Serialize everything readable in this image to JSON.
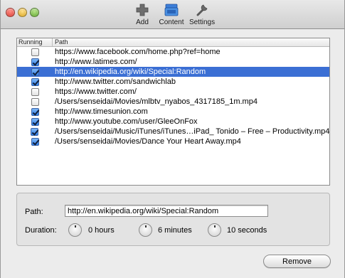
{
  "toolbar": {
    "buttons": [
      {
        "label": "Add",
        "icon": "add-plus-icon"
      },
      {
        "label": "Content",
        "icon": "content-tray-icon"
      },
      {
        "label": "Settings",
        "icon": "wrench-settings-icon"
      }
    ]
  },
  "list": {
    "columns": {
      "running": "Running",
      "path": "Path"
    },
    "rows": [
      {
        "checked": false,
        "path": "https://www.facebook.com/home.php?ref=home",
        "selected": false
      },
      {
        "checked": true,
        "path": "http://www.latimes.com/",
        "selected": false
      },
      {
        "checked": true,
        "path": "http://en.wikipedia.org/wiki/Special:Random",
        "selected": true
      },
      {
        "checked": true,
        "path": "http://www.twitter.com/sandwichlab",
        "selected": false
      },
      {
        "checked": false,
        "path": "https://www.twitter.com/",
        "selected": false
      },
      {
        "checked": false,
        "path": "/Users/senseidai/Movies/mlbtv_nyabos_4317185_1m.mp4",
        "selected": false
      },
      {
        "checked": true,
        "path": "http://www.timesunion.com",
        "selected": false
      },
      {
        "checked": true,
        "path": "http://www.youtube.com/user/GleeOnFox",
        "selected": false
      },
      {
        "checked": true,
        "path": "/Users/senseidai/Music/iTunes/iTunes…iPad_ Tonido – Free – Productivity.mp4",
        "selected": false
      },
      {
        "checked": true,
        "path": "/Users/senseidai/Movies/Dance Your Heart Away.mp4",
        "selected": false
      }
    ]
  },
  "detail": {
    "path_label": "Path:",
    "path_value": "http://en.wikipedia.org/wiki/Special:Random",
    "duration_label": "Duration:",
    "hours": "0 hours",
    "minutes": "6 minutes",
    "seconds": "10 seconds"
  },
  "actions": {
    "remove_label": "Remove"
  },
  "colors": {
    "selection": "#3b6fd4",
    "checkbox_checked": "#2f7ee8"
  }
}
